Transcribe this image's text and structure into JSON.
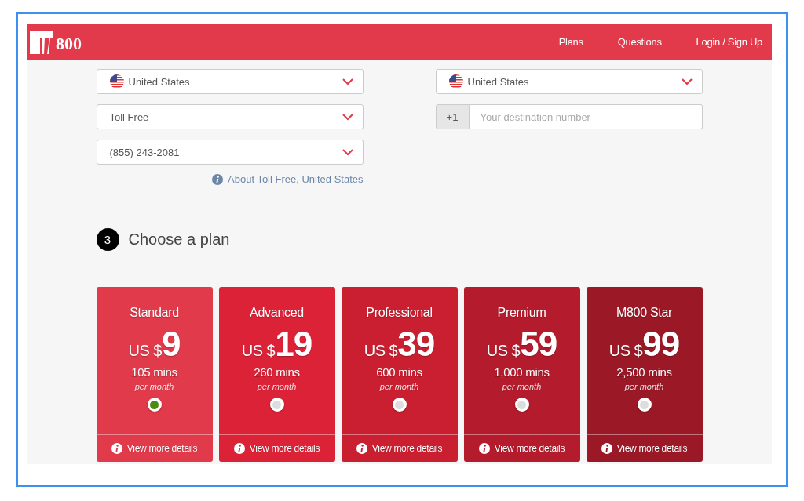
{
  "header": {
    "logo_text": "800",
    "nav": [
      {
        "label": "Plans"
      },
      {
        "label": "Questions"
      },
      {
        "label": "Login / Sign Up"
      }
    ]
  },
  "from": {
    "selects": [
      {
        "value": "United States",
        "flag": true
      },
      {
        "value": "Toll Free",
        "flag": false
      },
      {
        "value": "(855) 243-2081",
        "flag": false
      }
    ],
    "info_link": "About Toll Free, United States"
  },
  "to": {
    "country": {
      "value": "United States",
      "flag": true
    },
    "prefix": "+1",
    "placeholder": "Your destination number"
  },
  "step": {
    "number": "3",
    "title": "Choose a plan"
  },
  "plans": [
    {
      "name": "Standard",
      "currency": "US $",
      "price": "9",
      "minutes": "105 mins",
      "period": "per month",
      "selected": true,
      "color": "#e03a4b",
      "details": "View more details"
    },
    {
      "name": "Advanced",
      "currency": "US $",
      "price": "19",
      "minutes": "260 mins",
      "period": "per month",
      "selected": false,
      "color": "#dc2237",
      "details": "View more details"
    },
    {
      "name": "Professional",
      "currency": "US $",
      "price": "39",
      "minutes": "600 mins",
      "period": "per month",
      "selected": false,
      "color": "#c91f30",
      "details": "View more details"
    },
    {
      "name": "Premium",
      "currency": "US $",
      "price": "59",
      "minutes": "1,000 mins",
      "period": "per month",
      "selected": false,
      "color": "#b41b2c",
      "details": "View more details"
    },
    {
      "name": "M800 Star",
      "currency": "US $",
      "price": "99",
      "minutes": "2,500 mins",
      "period": "per month",
      "selected": false,
      "color": "#9b1826",
      "details": "View more details"
    }
  ]
}
